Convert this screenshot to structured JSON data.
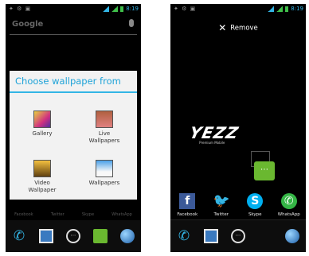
{
  "left_phone": {
    "search_placeholder": "Google",
    "dialog": {
      "title": "Choose wallpaper from",
      "options": [
        {
          "label": "Gallery"
        },
        {
          "label": "Live Wallpapers"
        },
        {
          "label": "Video Wallpaper"
        },
        {
          "label": "Wallpapers"
        }
      ]
    },
    "background_labels": [
      "Facebook",
      "Twitter",
      "Skype",
      "WhatsApp"
    ]
  },
  "right_phone": {
    "remove_label": "Remove",
    "logo_text": "YEZZ",
    "logo_subtext": "Premium Mobile",
    "social_apps": [
      {
        "label": "Facebook"
      },
      {
        "label": "Twitter"
      },
      {
        "label": "Skype"
      },
      {
        "label": "WhatsApp"
      }
    ]
  },
  "status_bar": {
    "time": "8:19"
  },
  "colors": {
    "accent_blue": "#33b5e5",
    "dialog_title": "#1ea3d8",
    "dialog_bg": "#f2f2f2",
    "message_green": "#6ab830"
  }
}
